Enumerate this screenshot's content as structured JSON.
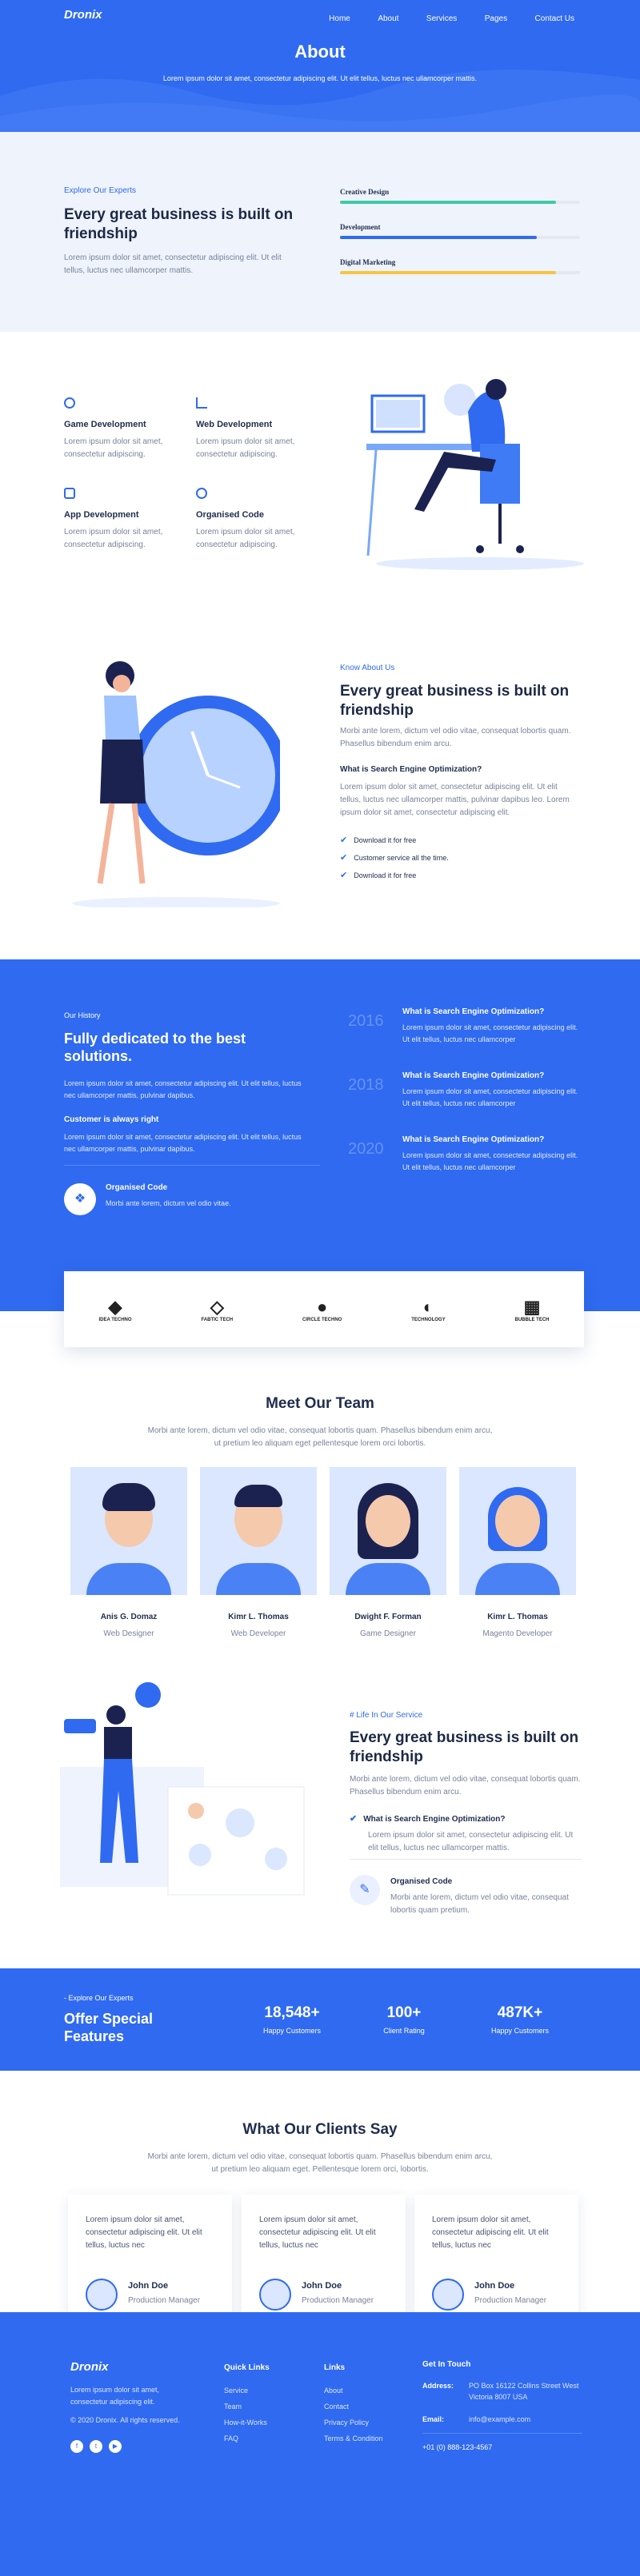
{
  "header": {
    "logo": "Dronix",
    "nav": [
      "Home",
      "About",
      "Services",
      "Pages",
      "Contact Us"
    ],
    "title": "About",
    "subtitle": "Lorem ipsum dolor sit amet, consectetur adipiscing elit. Ut elit tellus, luctus nec ullamcorper mattis."
  },
  "experts": {
    "eyebrow": "Explore Our Experts",
    "title": "Every great business is built on friendship",
    "text": "Lorem ipsum dolor sit amet, consectetur adipiscing elit. Ut elit tellus, luctus nec ullamcorper mattis.",
    "skills": [
      {
        "label": "Creative Design",
        "value": 0.9,
        "color": "#3fc9a6"
      },
      {
        "label": "Development",
        "value": 0.82,
        "color": "#2f6af0"
      },
      {
        "label": "Digital Marketing",
        "value": 0.9,
        "color": "#f5c542"
      }
    ]
  },
  "services": [
    {
      "title": "Game Development",
      "text": "Lorem ipsum dolor sit amet, consectetur adipiscing."
    },
    {
      "title": "Web Development",
      "text": "Lorem ipsum dolor sit amet, consectetur adipiscing."
    },
    {
      "title": "App Development",
      "text": "Lorem ipsum dolor sit amet, consectetur adipiscing."
    },
    {
      "title": "Organised Code",
      "text": "Lorem ipsum dolor sit amet, consectetur adipiscing."
    }
  ],
  "about": {
    "eyebrow": "Know About Us",
    "title": "Every great business is built on friendship",
    "text": "Morbi ante lorem, dictum vel odio vitae, consequat lobortis quam. Phasellus bibendum enim arcu.",
    "subtitle": "What is Search Engine Optimization?",
    "text2": "Lorem ipsum dolor sit amet, consectetur adipiscing elit. Ut elit tellus, luctus nec ullamcorper mattis, pulvinar dapibus leo. Lorem ipsum dolor sit amet, consectetur adipiscing elit.",
    "checks": [
      "Download it for free",
      "Customer service all the time.",
      "Download it for free"
    ]
  },
  "history": {
    "eyebrow": "Our History",
    "title": "Fully dedicated to the best solutions.",
    "text": "Lorem ipsum dolor sit amet, consectetur adipiscing elit. Ut elit tellus, luctus nec ullamcorper mattis, pulvinar dapibus.",
    "subtitle": "Customer is always right",
    "text2": "Lorem ipsum dolor sit amet, consectetur adipiscing elit. Ut elit tellus, luctus nec ullamcorper mattis, pulvinar dapibus.",
    "code_title": "Organised Code",
    "code_text": "Morbi ante lorem, dictum vel odio vitae.",
    "timeline": [
      {
        "year": "2016",
        "title": "What is Search Engine Optimization?",
        "text": "Lorem ipsum dolor sit amet, consectetur adipiscing elit. Ut elit tellus, luctus nec ullamcorper"
      },
      {
        "year": "2018",
        "title": "What is Search Engine Optimization?",
        "text": "Lorem ipsum dolor sit amet, consectetur adipiscing elit. Ut elit tellus, luctus nec ullamcorper"
      },
      {
        "year": "2020",
        "title": "What is Search Engine Optimization?",
        "text": "Lorem ipsum dolor sit amet, consectetur adipiscing elit. Ut elit tellus, luctus nec ullamcorper"
      }
    ]
  },
  "brands": [
    "IDEA TECHNO",
    "FABTIC TECH",
    "CIRCLE TECHNO",
    "TECHNOLOGY",
    "BUBBLE TECH"
  ],
  "team": {
    "title": "Meet Our Team",
    "text": "Morbi ante lorem, dictum vel odio vitae, consequat lobortis quam. Phasellus bibendum enim arcu, ut pretium leo aliquam eget pellentesque lorem orci lobortis.",
    "members": [
      {
        "name": "Anis G. Domaz",
        "role": "Web Designer"
      },
      {
        "name": "Kimr L. Thomas",
        "role": "Web Developer"
      },
      {
        "name": "Dwight F. Forman",
        "role": "Game Designer"
      },
      {
        "name": "Kimr L. Thomas",
        "role": "Magento Developer"
      }
    ]
  },
  "life": {
    "eyebrow": "# Life In Our Service",
    "title": "Every great business is built on friendship",
    "text": "Morbi ante lorem, dictum vel odio vitae, consequat lobortis quam. Phasellus bibendum enim arcu.",
    "check": "What is Search Engine Optimization?",
    "check_text": "Lorem ipsum dolor sit amet, consectetur adipiscing elit. Ut elit tellus, luctus nec ullamcorper mattis.",
    "code_title": "Organised Code",
    "code_text": "Morbi ante lorem, dictum vel odio vitae, consequat lobortis quam pretium."
  },
  "stats": {
    "eyebrow": "- Explore Our Experts",
    "title": "Offer Special Features",
    "items": [
      {
        "value": "18,548+",
        "label": "Happy Customers"
      },
      {
        "value": "100+",
        "label": "Client Rating"
      },
      {
        "value": "487K+",
        "label": "Happy Customers"
      }
    ]
  },
  "testimonials": {
    "title": "What Our Clients Say",
    "text": "Morbi ante lorem, dictum vel odio vitae, consequat lobortis quam. Phasellus bibendum enim arcu, ut pretium leo aliquam eget. Pellentesque lorem orci, lobortis.",
    "items": [
      {
        "quote": "Lorem ipsum dolor sit amet, consectetur adipiscing elit. Ut elit tellus, luctus nec",
        "name": "John Doe",
        "role": "Production Manager"
      },
      {
        "quote": "Lorem ipsum dolor sit amet, consectetur adipiscing elit. Ut elit tellus, luctus nec",
        "name": "John Doe",
        "role": "Production Manager"
      },
      {
        "quote": "Lorem ipsum dolor sit amet, consectetur adipiscing elit. Ut elit tellus, luctus nec",
        "name": "John Doe",
        "role": "Production Manager"
      }
    ]
  },
  "footer": {
    "logo": "Dronix",
    "text": "Lorem ipsum dolor sit amet, consectetur adipiscing elit.",
    "copyright": "© 2020 Dronix. All rights reserved.",
    "quick_title": "Quick Links",
    "quick": [
      "Service",
      "Team",
      "How-it-Works",
      "FAQ"
    ],
    "links_title": "Links",
    "links": [
      "About",
      "Contact",
      "Privacy Policy",
      "Terms & Condition"
    ],
    "touch_title": "Get In Touch",
    "address_label": "Address:",
    "address": "PO Box 16122 Collins Street West Victoria 8007 USA",
    "email_label": "Email:",
    "email": "info@example.com",
    "phone": "+01 (0) 888-123-4567",
    "social": [
      "f",
      "t",
      "▶"
    ]
  }
}
